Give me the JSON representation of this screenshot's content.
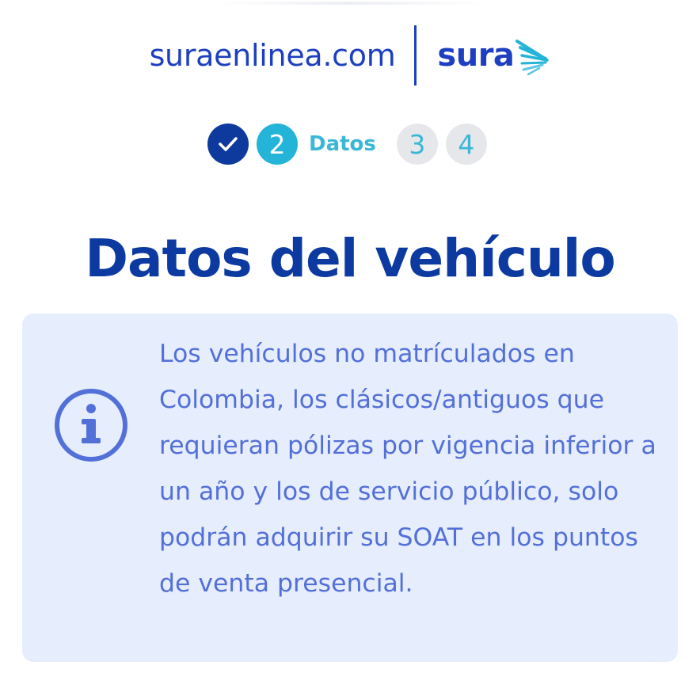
{
  "header": {
    "site_name": "suraenlinea.com",
    "logo_text": "sura"
  },
  "stepper": {
    "steps": [
      {
        "label": "",
        "state": "done",
        "icon": "check-icon"
      },
      {
        "label": "2",
        "state": "active"
      },
      {
        "label": "3",
        "state": "pending"
      },
      {
        "label": "4",
        "state": "pending"
      }
    ],
    "active_label": "Datos"
  },
  "main": {
    "title": "Datos del vehículo",
    "info": {
      "icon": "info-icon",
      "text": "Los vehículos no matrículados en Colombia, los clásicos/antiguos que requieran pólizas por vigencia inferior a un año y los de servicio público, solo podrán adquirir su SOAT en los puntos de venta presencial."
    }
  },
  "colors": {
    "brand_blue": "#1d3fc0",
    "title_blue": "#0c3aa0",
    "accent_cyan": "#23b4d8",
    "info_bg": "#e6edfd",
    "info_text": "#5370d8"
  }
}
